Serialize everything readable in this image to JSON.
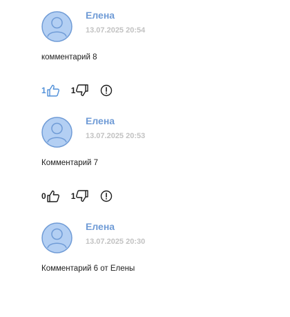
{
  "comments": [
    {
      "author": "Елена",
      "date": "13.07.2025 20:54",
      "text": "комментарий 8",
      "likes": "1",
      "dislikes": "1",
      "liked": true
    },
    {
      "author": "Елена",
      "date": "13.07.2025 20:53",
      "text": "Комментарий 7",
      "likes": "0",
      "dislikes": "1",
      "liked": false
    },
    {
      "author": "Елена",
      "date": "13.07.2025 20:30",
      "text": "Комментарий 6 от Елены",
      "likes": "",
      "dislikes": "",
      "liked": false
    }
  ],
  "icons": {
    "avatar": "user-avatar-icon",
    "like": "thumbs-up-icon",
    "dislike": "thumbs-down-icon",
    "report": "exclamation-circle-icon"
  },
  "colors": {
    "author": "#6f9bd6",
    "date": "#c2c2c2",
    "avatar_fill": "#b3cff3",
    "avatar_stroke": "#6f9bd6",
    "active_like": "#4f8fd8",
    "text": "#1c1c1c"
  }
}
